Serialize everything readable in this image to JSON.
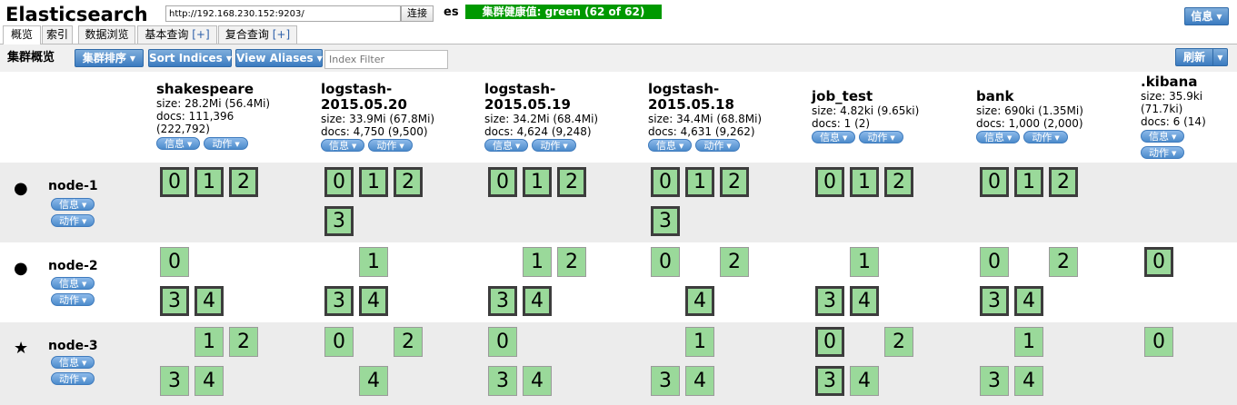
{
  "header": {
    "app_title": "Elasticsearch",
    "url": "http://192.168.230.152:9203/",
    "connect_label": "连接",
    "cluster_name": "es",
    "health": "集群健康值: green (62 of 62)",
    "health_color": "#009900",
    "info_label": "信息"
  },
  "tabs": [
    {
      "label": "概览"
    },
    {
      "label": "索引"
    },
    {
      "label": "数据浏览"
    },
    {
      "label": "基本查询",
      "suffix": "[+]"
    },
    {
      "label": "复合查询",
      "suffix": "[+]"
    }
  ],
  "toolbar": {
    "title": "集群概览",
    "sort_cluster": "集群排序",
    "sort_indices": "Sort Indices",
    "view_aliases": "View Aliases",
    "filter_placeholder": "Index Filter",
    "refresh": "刷新"
  },
  "labels": {
    "info": "信息",
    "action": "动作"
  },
  "indices": [
    {
      "name": "shakespeare",
      "size": "size: 28.2Mi (56.4Mi)",
      "docs": "docs: 111,396",
      "docs_total": "(222,792)"
    },
    {
      "name": "logstash-",
      "name2": "2015.05.20",
      "size": "size: 33.9Mi (67.8Mi)",
      "docs": "docs: 4,750 (9,500)"
    },
    {
      "name": "logstash-",
      "name2": "2015.05.19",
      "size": "size: 34.2Mi (68.4Mi)",
      "docs": "docs: 4,624 (9,248)"
    },
    {
      "name": "logstash-",
      "name2": "2015.05.18",
      "size": "size: 34.4Mi (68.8Mi)",
      "docs": "docs: 4,631 (9,262)"
    },
    {
      "name": "job_test",
      "size": "size: 4.82ki (9.65ki)",
      "docs": "docs: 1 (2)"
    },
    {
      "name": "bank",
      "size": "size: 690ki (1.35Mi)",
      "docs": "docs: 1,000 (2,000)"
    },
    {
      "name": ".kibana",
      "size": "size: 35.9ki",
      "size2": "(71.7ki)",
      "docs": "docs: 6 (14)"
    }
  ],
  "nodes": [
    {
      "name": "node-1",
      "icon": "circle-icon"
    },
    {
      "name": "node-2",
      "icon": "circle-icon"
    },
    {
      "name": "node-3",
      "icon": "star-icon"
    }
  ],
  "shards": {
    "node-1": [
      {
        "index": 0,
        "primary": [
          "0",
          "1",
          "2"
        ],
        "replica": []
      },
      {
        "index": 1,
        "primary": [
          "0",
          "1",
          "2",
          "3"
        ],
        "replica": []
      },
      {
        "index": 2,
        "primary": [
          "0",
          "1",
          "2"
        ],
        "replica": []
      },
      {
        "index": 3,
        "primary": [
          "0",
          "1",
          "2",
          "3"
        ],
        "replica": []
      },
      {
        "index": 4,
        "primary": [
          "0",
          "1",
          "2"
        ],
        "replica": []
      },
      {
        "index": 5,
        "primary": [
          "0",
          "1",
          "2"
        ],
        "replica": []
      },
      {
        "index": 6,
        "primary": [],
        "replica": []
      }
    ],
    "node-2": [
      {
        "index": 0,
        "primary": [
          "3",
          "4"
        ],
        "replica": [
          "0"
        ]
      },
      {
        "index": 1,
        "primary": [
          "3",
          "4"
        ],
        "replica": [
          "1"
        ]
      },
      {
        "index": 2,
        "primary": [
          "3",
          "4"
        ],
        "replica": [
          "1",
          "2"
        ]
      },
      {
        "index": 3,
        "primary": [
          "4"
        ],
        "replica": [
          "0",
          "2"
        ]
      },
      {
        "index": 4,
        "primary": [
          "3",
          "4"
        ],
        "replica": [
          "1"
        ]
      },
      {
        "index": 5,
        "primary": [
          "3",
          "4"
        ],
        "replica": [
          "0",
          "2"
        ]
      },
      {
        "index": 6,
        "primary": [
          "0"
        ],
        "replica": []
      }
    ],
    "node-3": [
      {
        "index": 0,
        "primary": [],
        "replica": [
          "1",
          "2",
          "3",
          "4"
        ]
      },
      {
        "index": 1,
        "primary": [],
        "replica": [
          "0",
          "2",
          "4"
        ]
      },
      {
        "index": 2,
        "primary": [],
        "replica": [
          "0",
          "3",
          "4"
        ]
      },
      {
        "index": 3,
        "primary": [],
        "replica": [
          "1",
          "3",
          "4"
        ]
      },
      {
        "index": 4,
        "primary": [
          "0",
          "3"
        ],
        "replica": [
          "2",
          "4"
        ]
      },
      {
        "index": 5,
        "primary": [],
        "replica": [
          "1",
          "3",
          "4"
        ]
      },
      {
        "index": 6,
        "primary": [],
        "replica": [
          "0"
        ]
      }
    ]
  }
}
